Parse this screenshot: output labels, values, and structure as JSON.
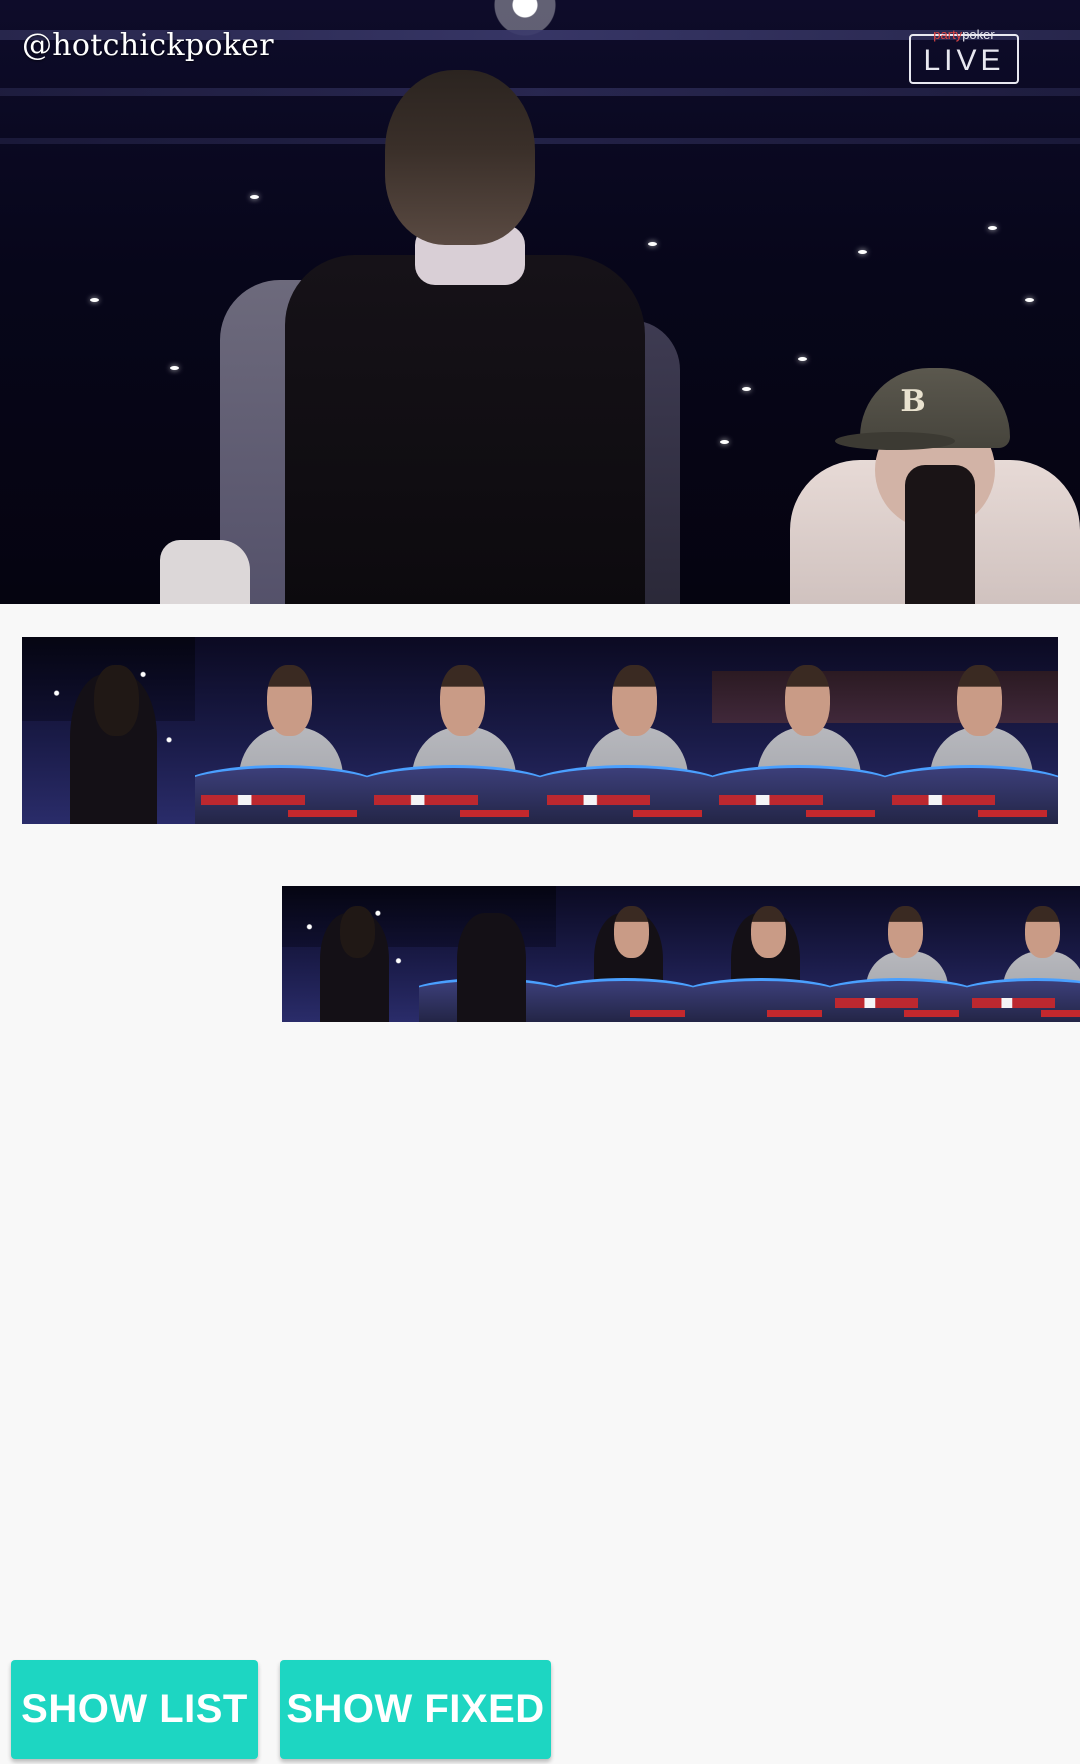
{
  "video": {
    "watermark": "@hotchickpoker",
    "brand_top_left": "party",
    "brand_top_right": "poker",
    "brand_word": "LIVE"
  },
  "strip_1": {
    "frames": [
      "back-view",
      "player-hoodie",
      "player-grey",
      "player-grey-thinking",
      "table-wide",
      "table-wide"
    ]
  },
  "strip_2": {
    "frames": [
      "back-view",
      "table-overview",
      "players-cap",
      "players-cap",
      "player-grey",
      "player-hoodie"
    ]
  },
  "buttons": {
    "show_list": "SHOW LIST",
    "show_fixed": "SHOW FIXED"
  },
  "colors": {
    "button_bg": "#1dd6c2",
    "button_text": "#ffffff",
    "page_bg": "#f8f8f8"
  }
}
